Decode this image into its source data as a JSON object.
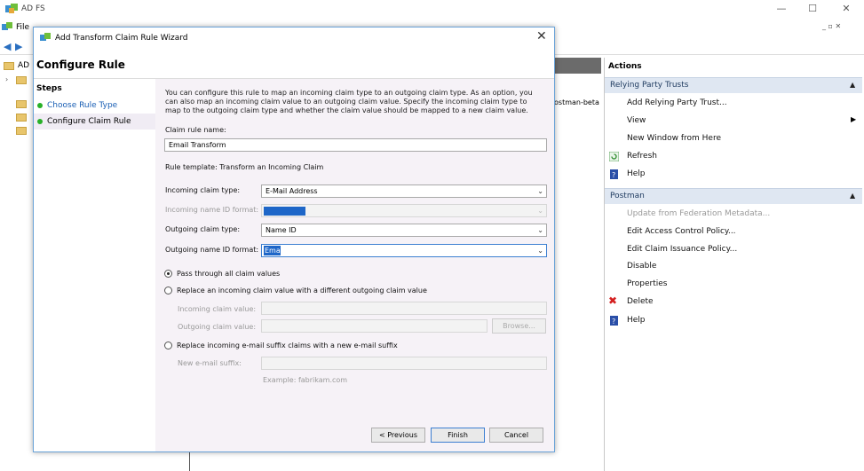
{
  "app": {
    "title": "AD FS"
  },
  "window_controls": {
    "minimize": "—",
    "maximize": "☐",
    "close": "✕",
    "mdi": "_ ▫ ✕"
  },
  "menu": {
    "file": "File"
  },
  "tree": {
    "root": "AD"
  },
  "center": {
    "row_text": "ostman-beta"
  },
  "actions": {
    "title": "Actions",
    "section1": {
      "label": "Relying Party Trusts",
      "items": [
        "Add Relying Party Trust...",
        "View",
        "New Window from Here",
        "Refresh",
        "Help"
      ]
    },
    "section2": {
      "label": "Postman",
      "items": [
        "Update from Federation Metadata...",
        "Edit Access Control Policy...",
        "Edit Claim Issuance Policy...",
        "Disable",
        "Properties",
        "Delete",
        "Help"
      ]
    }
  },
  "dialog": {
    "title": "Add Transform Claim Rule Wizard",
    "close": "✕",
    "heading": "Configure Rule",
    "steps_title": "Steps",
    "steps": [
      "Choose Rule Type",
      "Configure Claim Rule"
    ],
    "description": "You can configure this rule to map an incoming claim type to an outgoing claim type. As an option, you can also map an incoming claim value to an outgoing claim value. Specify the incoming claim type to map to the outgoing claim type and whether the claim value should be mapped to a new claim value.",
    "claim_rule_name_label": "Claim rule name:",
    "claim_rule_name_value": "Email Transform",
    "rule_template": "Rule template: Transform an Incoming Claim",
    "incoming_claim_type_label": "Incoming claim type:",
    "incoming_claim_type_value": "E-Mail Address",
    "incoming_name_id_label": "Incoming name ID format:",
    "outgoing_claim_type_label": "Outgoing claim type:",
    "outgoing_claim_type_value": "Name ID",
    "outgoing_name_id_label": "Outgoing name ID format:",
    "outgoing_name_id_value": "Email",
    "radio1": "Pass through all claim values",
    "radio2": "Replace an incoming claim value with a different outgoing claim value",
    "incoming_value_label": "Incoming claim value:",
    "outgoing_value_label": "Outgoing claim value:",
    "browse": "Browse...",
    "radio3": "Replace incoming e-mail suffix claims with a new e-mail suffix",
    "new_suffix_label": "New e-mail suffix:",
    "example": "Example: fabrikam.com",
    "previous": "< Previous",
    "finish": "Finish",
    "cancel": "Cancel"
  }
}
